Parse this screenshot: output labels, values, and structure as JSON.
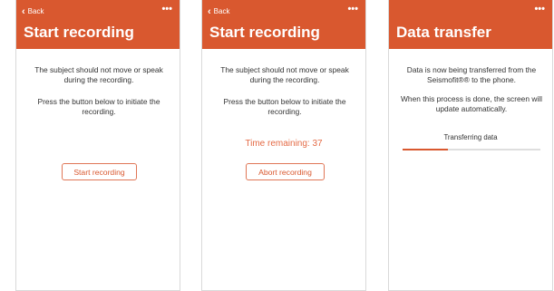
{
  "colors": {
    "accent": "#d9582f",
    "timer": "#e46a45",
    "track": "#dedede"
  },
  "screens": [
    {
      "back_label": "Back",
      "title": "Start recording",
      "instruction": "The subject should not move or speak during the recording.",
      "press_text": "Press the button below to initiate the recording.",
      "button_label": "Start recording"
    },
    {
      "back_label": "Back",
      "title": "Start recording",
      "instruction": "The subject should not move or speak during the recording.",
      "press_text": "Press the button below to initiate the recording.",
      "timer_text": "Time remaining: 37",
      "button_label": "Abort recording"
    },
    {
      "title": "Data transfer",
      "transfer_text": "Data is now being transferred from the Seismofit®® to the phone.",
      "auto_text": "When this process is done, the screen will update automatically.",
      "progress_label": "Transferring data",
      "progress_fraction": 0.33
    }
  ]
}
